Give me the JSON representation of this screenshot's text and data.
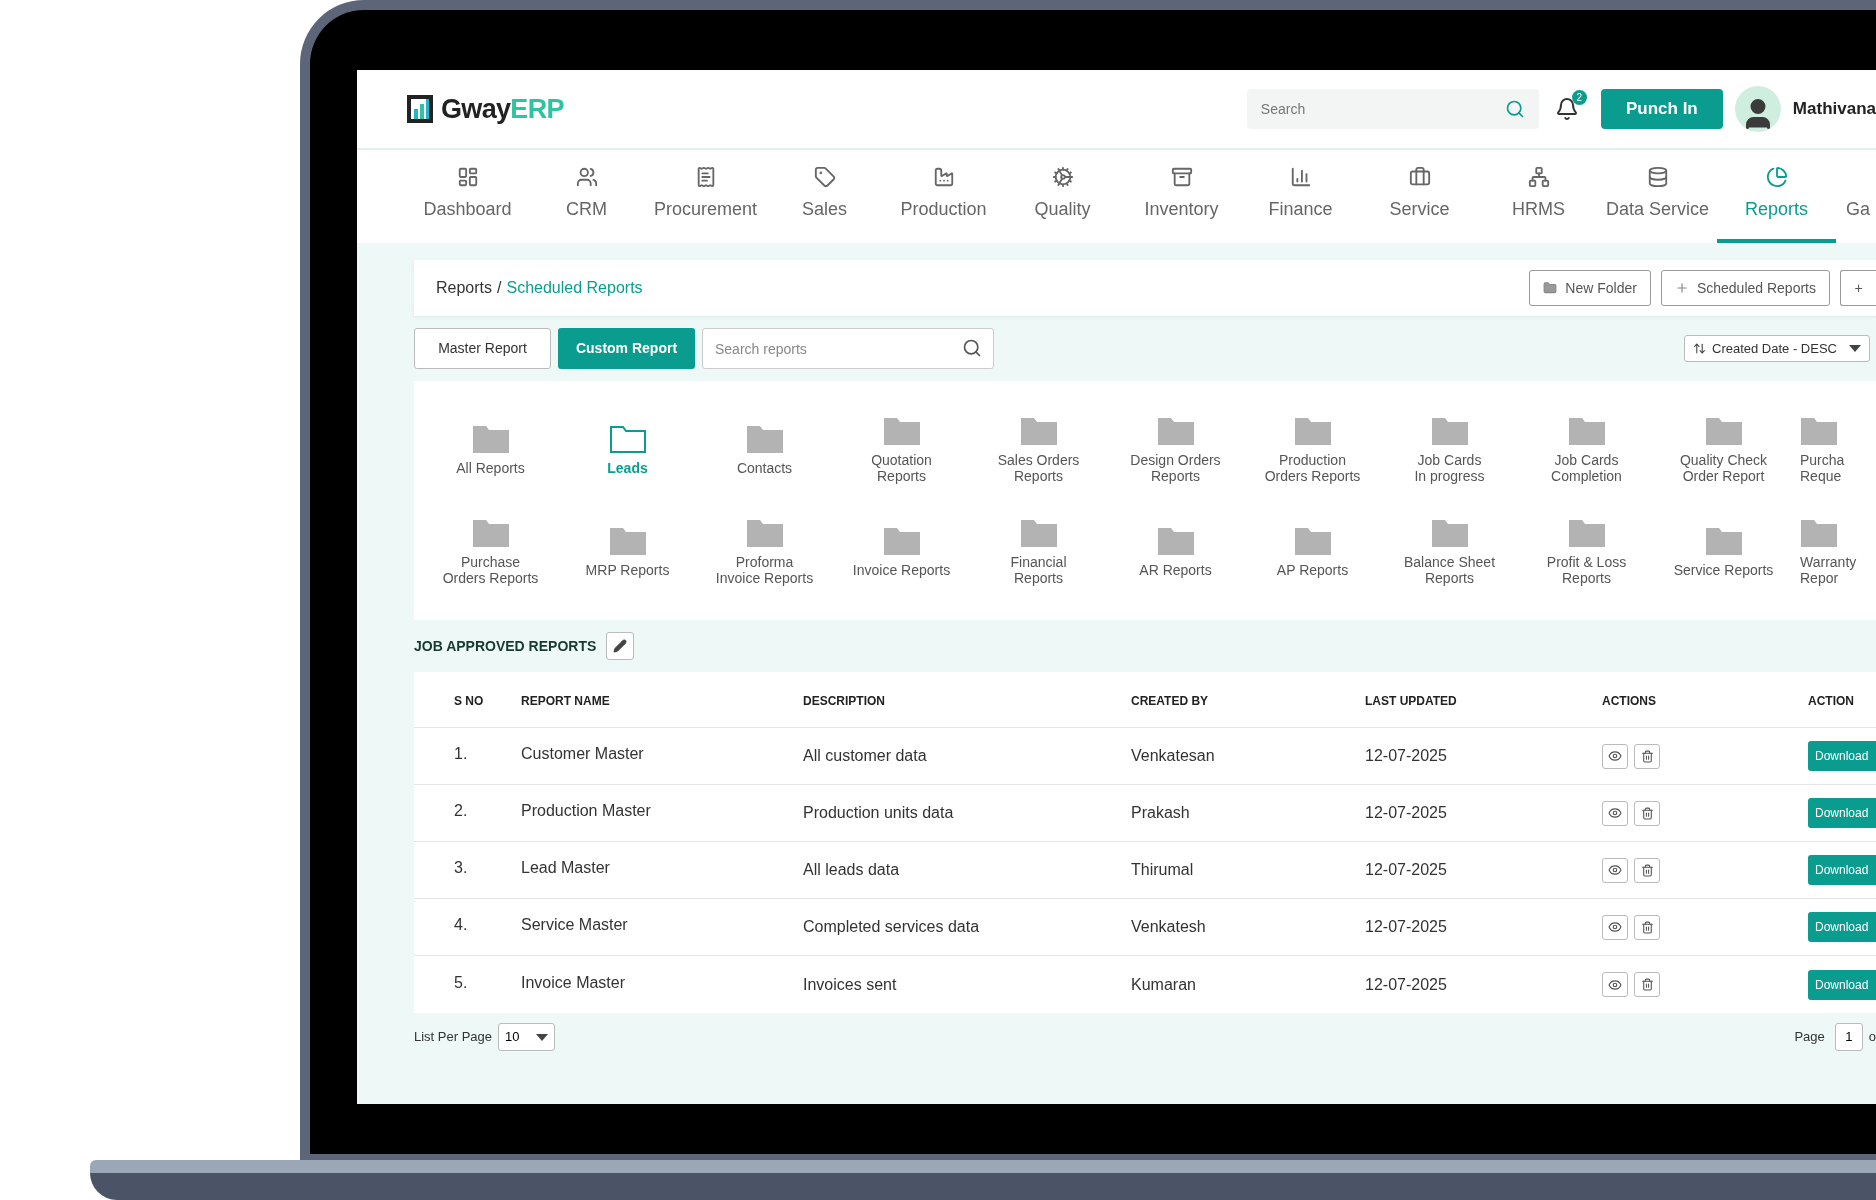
{
  "header": {
    "logo": {
      "brand": "Gway",
      "suffix": "ERP"
    },
    "search": {
      "placeholder": "Search"
    },
    "notifications": {
      "count": "2"
    },
    "punch_button": "Punch In",
    "user": {
      "name": "Mathivana"
    }
  },
  "nav": [
    {
      "label": "Dashboard",
      "selected": false
    },
    {
      "label": "CRM",
      "selected": false
    },
    {
      "label": "Procurement",
      "selected": false
    },
    {
      "label": "Sales",
      "selected": false
    },
    {
      "label": "Production",
      "selected": false
    },
    {
      "label": "Quality",
      "selected": false
    },
    {
      "label": "Inventory",
      "selected": false
    },
    {
      "label": "Finance",
      "selected": false
    },
    {
      "label": "Service",
      "selected": false
    },
    {
      "label": "HRMS",
      "selected": false
    },
    {
      "label": "Data Service",
      "selected": false
    },
    {
      "label": "Reports",
      "selected": true
    },
    {
      "label": "Ga",
      "selected": false
    }
  ],
  "breadcrumb": {
    "root": "Reports",
    "separator": "/",
    "current": "Scheduled Reports"
  },
  "toolbar_buttons": [
    "New Folder",
    "Scheduled Reports",
    "+"
  ],
  "report_tabs": [
    {
      "label": "Master Report",
      "selected": false
    },
    {
      "label": "Custom Report",
      "selected": true
    }
  ],
  "report_search": {
    "placeholder": "Search reports"
  },
  "sort": {
    "value": "Created Date - DESC"
  },
  "folders": [
    {
      "label": "All Reports",
      "selected": false
    },
    {
      "label": "Leads",
      "selected": true
    },
    {
      "label": "Contacts",
      "selected": false
    },
    {
      "label": "Quotation\nReports",
      "selected": false
    },
    {
      "label": "Sales Orders\nReports",
      "selected": false
    },
    {
      "label": "Design Orders\nReports",
      "selected": false
    },
    {
      "label": "Production\nOrders Reports",
      "selected": false
    },
    {
      "label": "Job Cards\nIn progress",
      "selected": false
    },
    {
      "label": "Job Cards\nCompletion",
      "selected": false
    },
    {
      "label": "Quality Check\nOrder Report",
      "selected": false
    },
    {
      "label": "Purcha\nReque",
      "selected": false
    },
    {
      "label": "Purchase\nOrders Reports",
      "selected": false
    },
    {
      "label": "MRP Reports",
      "selected": false
    },
    {
      "label": "Proforma\nInvoice Reports",
      "selected": false
    },
    {
      "label": "Invoice Reports",
      "selected": false
    },
    {
      "label": "Financial\nReports",
      "selected": false
    },
    {
      "label": "AR Reports",
      "selected": false
    },
    {
      "label": "AP Reports",
      "selected": false
    },
    {
      "label": "Balance Sheet\nReports",
      "selected": false
    },
    {
      "label": "Profit & Loss\nReports",
      "selected": false
    },
    {
      "label": "Service Reports",
      "selected": false
    },
    {
      "label": "Warranty\nRepor",
      "selected": false
    }
  ],
  "section_title": "JOB APPROVED REPORTS",
  "table": {
    "columns": [
      "S NO",
      "REPORT NAME",
      "DESCRIPTION",
      "CREATED BY",
      "LAST UPDATED",
      "ACTIONS",
      "ACTION"
    ],
    "rows": [
      {
        "sno": "1.",
        "name": "Customer Master",
        "description": "All customer data",
        "created_by": "Venkatesan",
        "last_updated": "12-07-2025",
        "action": "Download"
      },
      {
        "sno": "2.",
        "name": "Production Master",
        "description": "Production units data",
        "created_by": "Prakash",
        "last_updated": "12-07-2025",
        "action": "Download"
      },
      {
        "sno": "3.",
        "name": "Lead Master",
        "description": "All leads data",
        "created_by": "Thirumal",
        "last_updated": "12-07-2025",
        "action": "Download"
      },
      {
        "sno": "4.",
        "name": "Service Master",
        "description": "Completed services data",
        "created_by": "Venkatesh",
        "last_updated": "12-07-2025",
        "action": "Download"
      },
      {
        "sno": "5.",
        "name": "Invoice Master",
        "description": "Invoices sent",
        "created_by": "Kumaran",
        "last_updated": "12-07-2025",
        "action": "Download"
      }
    ]
  },
  "pagination": {
    "per_page_label": "List Per Page",
    "per_page": "10",
    "page_label": "Page",
    "page": "1",
    "of_label": "o"
  }
}
